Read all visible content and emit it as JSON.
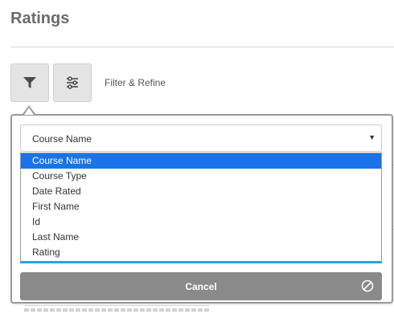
{
  "page": {
    "title": "Ratings"
  },
  "toolbar": {
    "filter_label": "Filter & Refine",
    "filter_icon": "funnel-icon",
    "settings_icon": "sliders-icon"
  },
  "filter_panel": {
    "select": {
      "value": "Course Name",
      "options": [
        "Course Name",
        "Course Type",
        "Date Rated",
        "First Name",
        "Id",
        "Last Name",
        "Rating"
      ],
      "highlighted_index": 0
    },
    "cancel_label": "Cancel",
    "cancel_icon": "cancel-circle-icon"
  },
  "colors": {
    "highlight": "#1a73e8",
    "focus_border": "#2aa4d8",
    "cancel_bg": "#8a8a8a",
    "button_bg": "#e4e4e4"
  }
}
